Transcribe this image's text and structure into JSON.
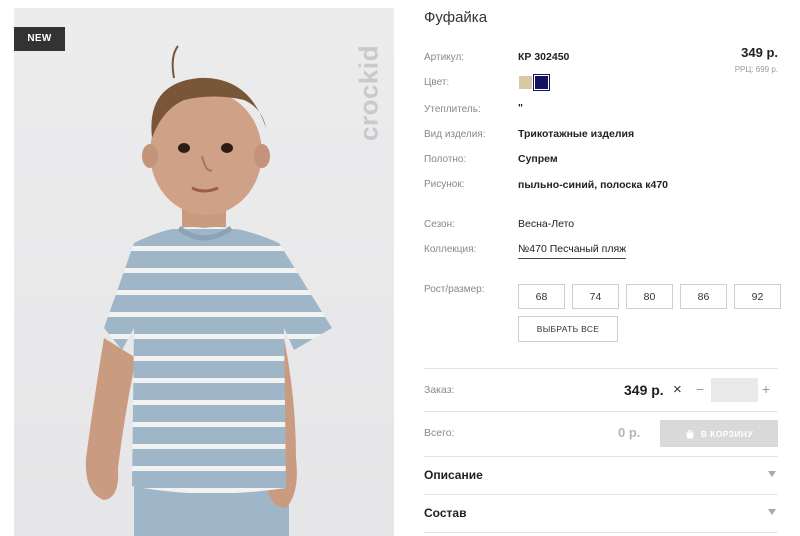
{
  "photo": {
    "badge": "NEW",
    "brand": "crockid"
  },
  "product": {
    "title": "Фуфайка",
    "price": "349 р.",
    "rrp": "РРЦ: 699 р."
  },
  "attributes": {
    "article": {
      "label": "Артикул:",
      "value": "КР 302450"
    },
    "color": {
      "label": "Цвет:",
      "swatches": [
        "#d8c9a4",
        "#15135f"
      ],
      "selected": "#15135f"
    },
    "insulation": {
      "label": "Утеплитель:",
      "value": "\""
    },
    "type": {
      "label": "Вид изделия:",
      "value": "Трикотажные изделия"
    },
    "fabric": {
      "label": "Полотно:",
      "value": "Супрем"
    },
    "pattern": {
      "label": "Рисунок:",
      "value": "пыльно-синий, полоска к470"
    },
    "season": {
      "label": "Сезон:",
      "value": "Весна-Лето"
    },
    "collection": {
      "label": "Коллекция:",
      "value": "№470 Песчаный пляж"
    }
  },
  "sizes": {
    "label": "Рост/размер:",
    "options": [
      "68",
      "74",
      "80",
      "86",
      "92"
    ],
    "select_all": "ВЫБРАТЬ ВСЕ"
  },
  "order": {
    "label": "Заказ:",
    "price": "349 р.",
    "multiply": "×",
    "minus": "−",
    "plus": "+",
    "quantity": ""
  },
  "total": {
    "label": "Всего:",
    "value": "0 р.",
    "cart_button": "В КОРЗИНУ"
  },
  "sections": {
    "description": "Описание",
    "composition": "Состав"
  },
  "icons": {
    "cart": "shopping-bag-icon",
    "chevron": "chevron-down-icon"
  },
  "colors": {
    "accent_dark": "#333333",
    "muted": "#888888",
    "cart_disabled": "#d9d9d9"
  }
}
